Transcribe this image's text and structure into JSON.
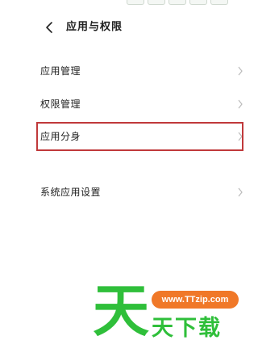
{
  "header": {
    "title": "应用与权限"
  },
  "menu": {
    "items": [
      {
        "label": "应用管理"
      },
      {
        "label": "权限管理"
      },
      {
        "label": "应用分身"
      },
      {
        "label": "系统应用设置"
      }
    ]
  },
  "watermark": {
    "url": "www.TTzip.com",
    "big_char": "天",
    "small_text": "天下载"
  },
  "colors": {
    "highlight_border": "#c0393b",
    "watermark_green": "#2fbf3a",
    "watermark_orange": "#f07828",
    "chevron": "#bbbbbb"
  }
}
